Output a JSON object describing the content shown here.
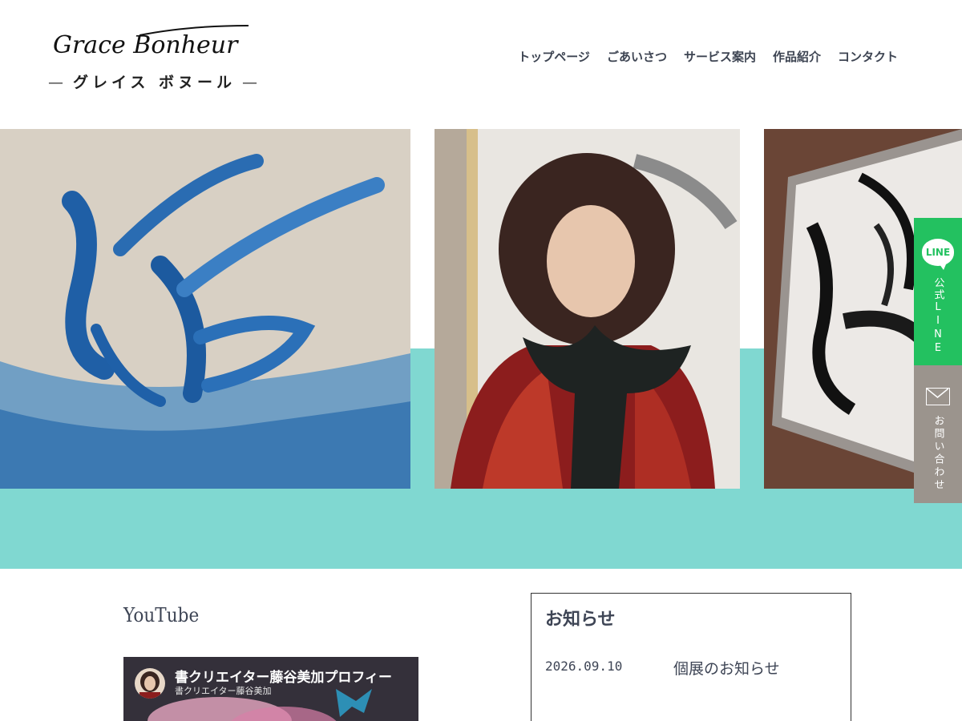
{
  "header": {
    "logo_script": "Grace Bonheur",
    "logo_sub": "グレイス ボヌール",
    "logo_dash": "—"
  },
  "nav": [
    "トップページ",
    "ごあいさつ",
    "サービス案内",
    "作品紹介",
    "コンタクト"
  ],
  "hero": {
    "panels": [
      "calligraphy-sea",
      "portrait",
      "calligraphy-framed"
    ],
    "accent_color": "#80d8d1"
  },
  "side": {
    "line_badge": "LINE",
    "line_label": "公式LINE",
    "line_color": "#23c160",
    "contact_label": "お問い合わせ",
    "contact_color": "#9b948d"
  },
  "youtube": {
    "heading": "YouTube",
    "video_title": "書クリエイター藤谷美加プロフィー",
    "video_channel": "書クリエイター藤谷美加"
  },
  "news": {
    "heading": "お知らせ",
    "items": [
      {
        "date": "2026.09.10",
        "text": "個展のお知らせ"
      }
    ]
  }
}
